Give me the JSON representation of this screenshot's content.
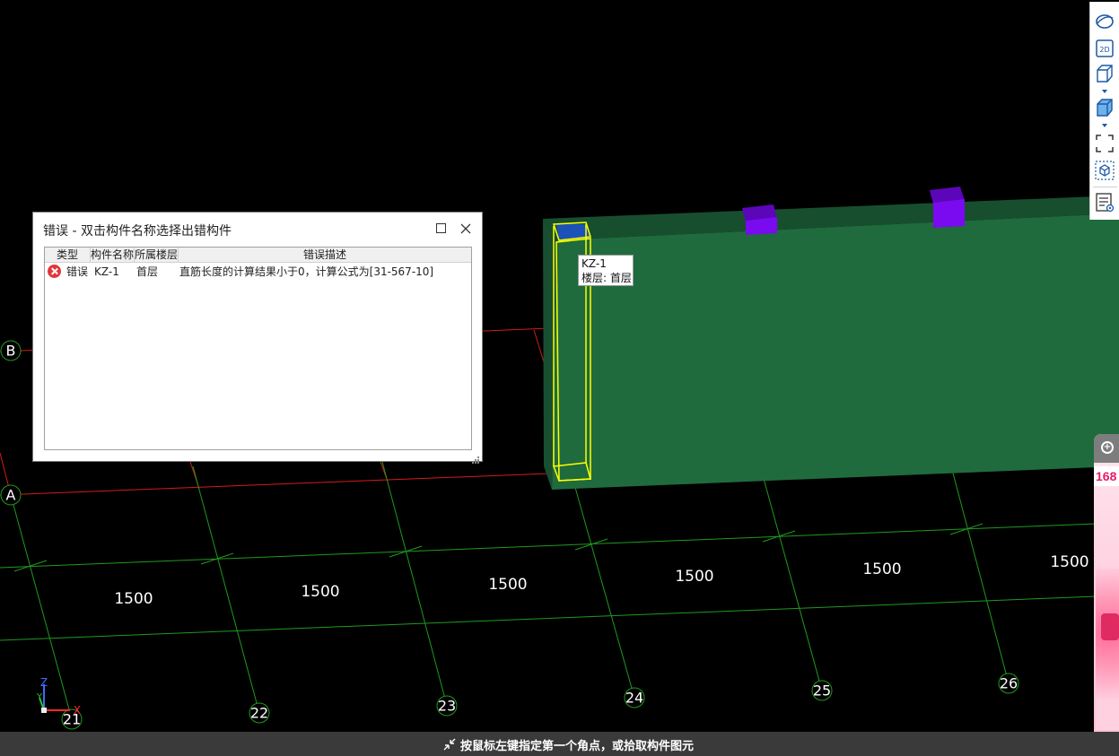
{
  "viewport": {
    "dimension_labels": [
      "1500",
      "1500",
      "1500",
      "1500",
      "1500",
      "1500"
    ],
    "column_axes": [
      "21",
      "22",
      "23",
      "24",
      "25",
      "26"
    ],
    "row_axes": [
      "B",
      "A"
    ],
    "coordinate_indicator": {
      "z": "Z",
      "y": "Y",
      "x": "X"
    },
    "colors": {
      "background": "#000000",
      "grid_line": "#1f9a1f",
      "axis_line": "#d61a1a",
      "beam": "#1f6b3e",
      "beam_top": "#174f2e",
      "selection": "#ffff00",
      "column_top": "#1b52b8",
      "column_purple": "#7a0af0"
    }
  },
  "toolbar": {
    "icons": [
      "orbit-icon",
      "2d-view-icon",
      "3d-box-icon",
      "3d-shaded-box-icon",
      "fit-view-icon",
      "local-3d-icon",
      "display-settings-icon"
    ]
  },
  "dialog": {
    "title": "错误 - 双击构件名称选择出错构件",
    "columns": [
      "类型",
      "构件名称",
      "所属楼层",
      "错误描述"
    ],
    "rows": [
      {
        "type": "错误",
        "name": "KZ-1",
        "floor": "首层",
        "description": "直筋长度的计算结果小于0，计算公式为[31-567-10]"
      }
    ]
  },
  "tooltip": {
    "name": "KZ-1",
    "floor": "楼层: 首层"
  },
  "ad_panel": {
    "badge": "168"
  },
  "status_bar": {
    "text": "按鼠标左键指定第一个角点，或拾取构件图元"
  }
}
